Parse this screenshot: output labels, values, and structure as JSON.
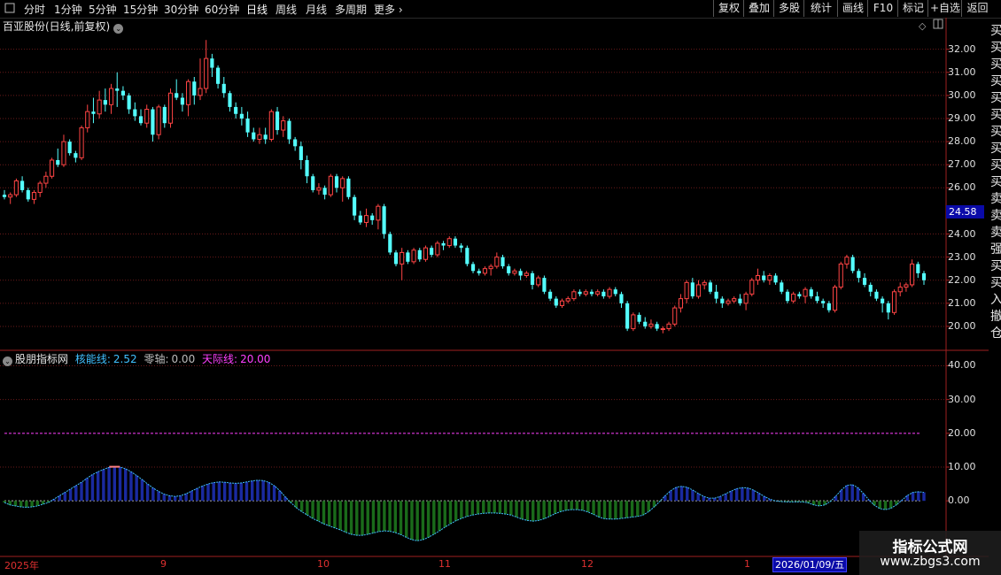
{
  "toolbar": {
    "left_items": [
      "分时",
      "1分钟",
      "5分钟",
      "15分钟",
      "30分钟",
      "60分钟",
      "日线",
      "周线",
      "月线",
      "多周期",
      "更多"
    ],
    "right_items": [
      "复权",
      "叠加",
      "多股",
      "统计",
      "画线",
      "F10",
      "标记",
      "+自选",
      "返回"
    ],
    "active": "日线"
  },
  "main_chart": {
    "title": "百亚股份(日线,前复权)",
    "price_axis": [
      "32.00",
      "31.00",
      "30.00",
      "29.00",
      "28.00",
      "27.00",
      "26.00",
      "24.00",
      "23.00",
      "22.00",
      "21.00",
      "20.00"
    ],
    "current_price": "24.58"
  },
  "indicator": {
    "name": "股朋指标网",
    "line1_label": "核能线:",
    "line1_value": "2.52",
    "line2_label": "零轴:",
    "line2_value": "0.00",
    "line3_label": "天际线:",
    "line3_value": "20.00",
    "axis": [
      "40.00",
      "30.00",
      "20.00",
      "10.00",
      "0.00"
    ],
    "colors": {
      "line1": "#40c0ff",
      "line2": "#bbbbbb",
      "line3": "#ff40ff",
      "pos": "#1a2aa0",
      "neg": "#1a6a1a"
    }
  },
  "date_axis": {
    "labels": [
      "2025年",
      "9",
      "10",
      "11",
      "12",
      "1"
    ],
    "current": "2026/01/09/五"
  },
  "right_strip_chars": "买买买买买买买买买买卖卖卖强买买入撤仓",
  "watermark": {
    "line1": "指标公式网",
    "line2": "www.zbgs3.com"
  },
  "chart_data": {
    "type": "candlestick",
    "candles": [
      [
        25.7,
        25.9,
        25.5,
        25.6
      ],
      [
        25.6,
        25.8,
        25.3,
        25.7
      ],
      [
        25.7,
        26.4,
        25.6,
        26.3
      ],
      [
        26.3,
        26.5,
        25.8,
        25.9
      ],
      [
        25.9,
        26.0,
        25.4,
        25.5
      ],
      [
        25.5,
        25.9,
        25.3,
        25.8
      ],
      [
        25.8,
        26.3,
        25.6,
        26.2
      ],
      [
        26.2,
        26.7,
        26.0,
        26.5
      ],
      [
        26.5,
        27.3,
        26.4,
        27.2
      ],
      [
        27.2,
        27.7,
        26.9,
        27.0
      ],
      [
        27.0,
        28.3,
        26.9,
        28.0
      ],
      [
        28.0,
        28.1,
        27.4,
        27.5
      ],
      [
        27.5,
        27.6,
        27.1,
        27.3
      ],
      [
        27.3,
        28.7,
        27.2,
        28.6
      ],
      [
        28.6,
        29.6,
        28.4,
        29.3
      ],
      [
        29.3,
        29.9,
        28.8,
        29.2
      ],
      [
        29.2,
        30.2,
        29.0,
        29.8
      ],
      [
        29.8,
        30.3,
        29.3,
        29.6
      ],
      [
        29.6,
        30.5,
        29.2,
        30.3
      ],
      [
        30.3,
        31.0,
        29.5,
        30.2
      ],
      [
        30.2,
        30.4,
        29.8,
        30.0
      ],
      [
        30.0,
        30.1,
        29.2,
        29.4
      ],
      [
        29.4,
        29.7,
        28.9,
        29.1
      ],
      [
        29.1,
        29.4,
        28.7,
        28.8
      ],
      [
        28.8,
        29.6,
        28.6,
        29.4
      ],
      [
        29.4,
        29.5,
        28.0,
        28.3
      ],
      [
        28.3,
        29.6,
        28.1,
        29.5
      ],
      [
        29.5,
        29.6,
        28.6,
        28.8
      ],
      [
        28.8,
        30.3,
        28.6,
        30.1
      ],
      [
        30.1,
        30.7,
        29.8,
        29.9
      ],
      [
        29.9,
        30.1,
        29.3,
        29.6
      ],
      [
        29.6,
        30.7,
        29.1,
        30.6
      ],
      [
        30.6,
        30.8,
        29.6,
        30.0
      ],
      [
        30.0,
        31.6,
        29.8,
        30.3
      ],
      [
        30.3,
        32.4,
        30.1,
        31.6
      ],
      [
        31.6,
        31.8,
        30.8,
        31.2
      ],
      [
        31.2,
        31.3,
        30.3,
        30.5
      ],
      [
        30.5,
        30.8,
        29.9,
        30.1
      ],
      [
        30.1,
        30.2,
        29.3,
        29.5
      ],
      [
        29.5,
        29.7,
        29.0,
        29.2
      ],
      [
        29.2,
        29.5,
        28.7,
        29.0
      ],
      [
        29.0,
        29.3,
        28.2,
        28.4
      ],
      [
        28.4,
        28.6,
        28.0,
        28.1
      ],
      [
        28.1,
        28.6,
        27.9,
        28.3
      ],
      [
        28.3,
        28.6,
        27.9,
        28.1
      ],
      [
        28.1,
        29.4,
        28.0,
        29.3
      ],
      [
        29.3,
        29.5,
        28.3,
        28.5
      ],
      [
        28.5,
        29.1,
        28.2,
        28.9
      ],
      [
        28.9,
        29.0,
        27.9,
        28.1
      ],
      [
        28.1,
        28.2,
        27.6,
        27.8
      ],
      [
        27.8,
        28.0,
        26.8,
        27.2
      ],
      [
        27.2,
        27.4,
        26.2,
        26.5
      ],
      [
        26.5,
        26.6,
        25.8,
        25.9
      ],
      [
        25.9,
        26.2,
        25.7,
        26.0
      ],
      [
        26.0,
        26.1,
        25.5,
        25.7
      ],
      [
        25.7,
        26.6,
        25.6,
        26.5
      ],
      [
        26.5,
        26.6,
        25.8,
        26.0
      ],
      [
        26.0,
        26.5,
        25.4,
        26.4
      ],
      [
        26.4,
        26.5,
        25.5,
        25.6
      ],
      [
        25.6,
        25.7,
        24.6,
        24.8
      ],
      [
        24.8,
        25.0,
        24.4,
        24.5
      ],
      [
        24.5,
        25.1,
        24.3,
        24.8
      ],
      [
        24.8,
        24.9,
        24.4,
        24.6
      ],
      [
        24.6,
        25.3,
        24.2,
        25.2
      ],
      [
        25.2,
        25.3,
        23.8,
        24.0
      ],
      [
        24.0,
        24.1,
        23.1,
        23.2
      ],
      [
        23.2,
        23.3,
        22.6,
        22.7
      ],
      [
        22.7,
        23.4,
        22.0,
        23.2
      ],
      [
        23.2,
        23.3,
        22.7,
        22.8
      ],
      [
        22.8,
        23.4,
        22.7,
        23.3
      ],
      [
        23.3,
        23.4,
        22.8,
        22.9
      ],
      [
        22.9,
        23.5,
        22.8,
        23.4
      ],
      [
        23.4,
        23.5,
        23.0,
        23.1
      ],
      [
        23.1,
        23.7,
        23.0,
        23.6
      ],
      [
        23.6,
        23.7,
        23.3,
        23.5
      ],
      [
        23.5,
        23.9,
        23.4,
        23.8
      ],
      [
        23.8,
        23.9,
        23.4,
        23.5
      ],
      [
        23.5,
        23.6,
        23.2,
        23.4
      ],
      [
        23.4,
        23.5,
        22.6,
        22.7
      ],
      [
        22.7,
        22.8,
        22.3,
        22.4
      ],
      [
        22.4,
        22.5,
        22.2,
        22.3
      ],
      [
        22.3,
        22.6,
        22.2,
        22.5
      ],
      [
        22.5,
        22.7,
        22.2,
        22.6
      ],
      [
        22.6,
        23.2,
        22.5,
        23.0
      ],
      [
        23.0,
        23.1,
        22.5,
        22.6
      ],
      [
        22.6,
        22.7,
        22.2,
        22.3
      ],
      [
        22.3,
        22.5,
        22.2,
        22.4
      ],
      [
        22.4,
        22.5,
        22.0,
        22.2
      ],
      [
        22.2,
        22.4,
        22.1,
        22.3
      ],
      [
        22.3,
        22.4,
        21.6,
        21.8
      ],
      [
        21.8,
        22.2,
        21.7,
        22.1
      ],
      [
        22.1,
        22.2,
        21.4,
        21.5
      ],
      [
        21.5,
        21.6,
        21.1,
        21.2
      ],
      [
        21.2,
        21.3,
        20.8,
        20.9
      ],
      [
        20.9,
        21.2,
        20.8,
        21.1
      ],
      [
        21.1,
        21.3,
        21.0,
        21.2
      ],
      [
        21.2,
        21.6,
        21.1,
        21.5
      ],
      [
        21.5,
        21.6,
        21.3,
        21.4
      ],
      [
        21.4,
        21.6,
        21.3,
        21.5
      ],
      [
        21.5,
        21.6,
        21.3,
        21.4
      ],
      [
        21.4,
        21.6,
        21.3,
        21.5
      ],
      [
        21.5,
        21.6,
        21.2,
        21.3
      ],
      [
        21.3,
        21.7,
        21.2,
        21.6
      ],
      [
        21.6,
        21.7,
        21.3,
        21.4
      ],
      [
        21.4,
        21.5,
        20.8,
        21.0
      ],
      [
        21.0,
        21.1,
        19.8,
        19.9
      ],
      [
        19.9,
        20.6,
        19.8,
        20.5
      ],
      [
        20.5,
        20.6,
        20.1,
        20.2
      ],
      [
        20.2,
        20.4,
        19.9,
        20.0
      ],
      [
        20.0,
        20.3,
        19.9,
        20.1
      ],
      [
        20.1,
        20.2,
        19.8,
        19.9
      ],
      [
        19.9,
        20.0,
        19.7,
        19.9
      ],
      [
        19.9,
        20.2,
        19.8,
        20.1
      ],
      [
        20.1,
        20.9,
        20.0,
        20.8
      ],
      [
        20.8,
        21.4,
        20.6,
        21.2
      ],
      [
        21.2,
        22.0,
        21.0,
        21.9
      ],
      [
        21.9,
        22.1,
        21.2,
        21.3
      ],
      [
        21.3,
        22.0,
        21.2,
        21.8
      ],
      [
        21.8,
        22.0,
        21.6,
        21.9
      ],
      [
        21.9,
        22.0,
        21.4,
        21.5
      ],
      [
        21.5,
        21.8,
        21.0,
        21.2
      ],
      [
        21.2,
        21.3,
        20.8,
        21.0
      ],
      [
        21.0,
        21.2,
        20.9,
        21.1
      ],
      [
        21.1,
        21.3,
        21.0,
        21.2
      ],
      [
        21.2,
        21.4,
        20.9,
        21.0
      ],
      [
        21.0,
        21.5,
        20.7,
        21.4
      ],
      [
        21.4,
        22.1,
        21.3,
        22.0
      ],
      [
        22.0,
        22.5,
        21.8,
        22.2
      ],
      [
        22.2,
        22.4,
        21.9,
        22.0
      ],
      [
        22.0,
        22.3,
        21.8,
        22.2
      ],
      [
        22.2,
        22.3,
        21.8,
        21.9
      ],
      [
        21.9,
        22.0,
        21.4,
        21.5
      ],
      [
        21.5,
        21.6,
        21.0,
        21.1
      ],
      [
        21.1,
        21.5,
        21.0,
        21.4
      ],
      [
        21.4,
        21.5,
        21.2,
        21.3
      ],
      [
        21.3,
        21.7,
        21.0,
        21.6
      ],
      [
        21.6,
        21.7,
        21.2,
        21.3
      ],
      [
        21.3,
        21.5,
        21.0,
        21.1
      ],
      [
        21.1,
        21.2,
        20.8,
        21.0
      ],
      [
        21.0,
        21.1,
        20.6,
        20.7
      ],
      [
        20.7,
        21.8,
        20.6,
        21.7
      ],
      [
        21.7,
        22.8,
        21.6,
        22.7
      ],
      [
        22.7,
        23.1,
        22.5,
        23.0
      ],
      [
        23.0,
        23.1,
        22.3,
        22.4
      ],
      [
        22.4,
        22.5,
        21.9,
        22.1
      ],
      [
        22.1,
        22.3,
        21.7,
        21.8
      ],
      [
        21.8,
        21.9,
        21.3,
        21.5
      ],
      [
        21.5,
        21.6,
        21.1,
        21.2
      ],
      [
        21.2,
        21.3,
        20.6,
        21.0
      ],
      [
        21.0,
        21.1,
        20.3,
        20.6
      ],
      [
        20.6,
        21.6,
        20.5,
        21.5
      ],
      [
        21.5,
        21.9,
        21.3,
        21.7
      ],
      [
        21.7,
        21.9,
        21.5,
        21.8
      ],
      [
        21.8,
        22.9,
        21.7,
        22.7
      ],
      [
        22.7,
        22.8,
        22.1,
        22.3
      ],
      [
        22.3,
        22.4,
        21.8,
        22.0
      ]
    ],
    "ind_values": [
      -0.5,
      -1.2,
      -1.5,
      -1.8,
      -1.9,
      -1.8,
      -1.5,
      -1.0,
      -0.5,
      0.5,
      1.5,
      2.5,
      3.5,
      4.5,
      5.5,
      6.7,
      7.8,
      8.6,
      9.3,
      9.9,
      10.1,
      10.0,
      9.5,
      8.6,
      7.5,
      6.3,
      5.0,
      3.8,
      2.8,
      2.0,
      1.5,
      1.3,
      1.5,
      2.1,
      2.9,
      3.7,
      4.4,
      5.0,
      5.4,
      5.6,
      5.5,
      5.3,
      5.2,
      5.3,
      5.6,
      5.9,
      6.1,
      6.0,
      5.5,
      4.5,
      3.0,
      1.2,
      -0.5,
      -2.0,
      -3.2,
      -4.2,
      -5.2,
      -6.0,
      -6.8,
      -7.4,
      -8.0,
      -8.6,
      -9.3,
      -9.9,
      -10.2,
      -10.2,
      -9.9,
      -9.5,
      -9.1,
      -8.9,
      -9.0,
      -9.4,
      -10.0,
      -10.8,
      -11.5,
      -11.8,
      -11.5,
      -10.8,
      -9.9,
      -8.9,
      -7.8,
      -6.8,
      -5.9,
      -5.2,
      -4.6,
      -4.2,
      -3.9,
      -3.7,
      -3.6,
      -3.6,
      -3.7,
      -3.9,
      -4.2,
      -4.8,
      -5.4,
      -5.8,
      -6.0,
      -5.8,
      -5.3,
      -4.6,
      -3.8,
      -3.2,
      -2.8,
      -2.6,
      -2.6,
      -2.8,
      -3.3,
      -4.0,
      -4.8,
      -5.3,
      -5.4,
      -5.4,
      -5.2,
      -5.0,
      -4.8,
      -4.6,
      -4.2,
      -3.2,
      -1.8,
      -0.2,
      1.5,
      3.0,
      4.0,
      4.3,
      4.0,
      3.2,
      2.2,
      1.3,
      0.8,
      0.8,
      1.3,
      2.1,
      2.9,
      3.6,
      3.9,
      3.8,
      3.2,
      2.3,
      1.3,
      0.5,
      0.0,
      -0.2,
      -0.3,
      -0.3,
      -0.3,
      -0.3,
      -0.6,
      -1.2,
      -1.5,
      -1.2,
      -0.2,
      1.4,
      3.2,
      4.6,
      4.8,
      3.9,
      2.2,
      0.3,
      -1.3,
      -2.3,
      -2.6,
      -2.2,
      -1.2,
      0.2,
      1.6,
      2.5,
      2.7,
      2.52
    ],
    "ylim_price": [
      19.5,
      32.6
    ],
    "ylim_indicator": [
      -12,
      43
    ]
  }
}
